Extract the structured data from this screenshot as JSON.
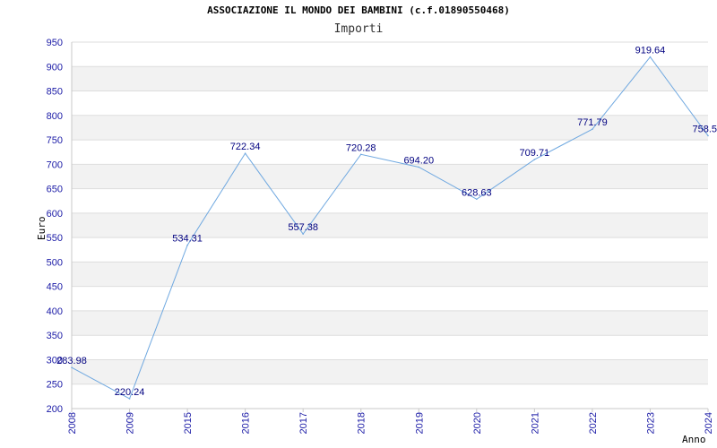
{
  "chart_data": {
    "type": "line",
    "title": "ASSOCIAZIONE IL MONDO DEI BAMBINI (c.f.01890550468)",
    "subtitle": "Importi",
    "xlabel": "Anno",
    "ylabel": "Euro",
    "categories": [
      "2008",
      "2009",
      "2015",
      "2016",
      "2017",
      "2018",
      "2019",
      "2020",
      "2021",
      "2022",
      "2023",
      "2024"
    ],
    "series": [
      {
        "values": [
          283.98,
          220.24,
          534.31,
          722.34,
          557.38,
          720.28,
          694.2,
          628.63,
          709.71,
          771.79,
          919.64,
          758.5
        ],
        "labels": [
          "283.98",
          "220.24",
          "534.31",
          "722.34",
          "557.38",
          "720.28",
          "694.20",
          "628.63",
          "709.71",
          "771.79",
          "919.64",
          "758.5"
        ]
      }
    ],
    "yticks": [
      "200",
      "250",
      "300",
      "350",
      "400",
      "450",
      "500",
      "550",
      "600",
      "650",
      "700",
      "750",
      "800",
      "850",
      "900",
      "950"
    ],
    "ylim": [
      200,
      950
    ],
    "grid": true,
    "line_color": "#6fa8e0",
    "band_color": "#f2f2f2",
    "grid_color": "#dddddd",
    "axis_color": "#c8c8c8"
  }
}
